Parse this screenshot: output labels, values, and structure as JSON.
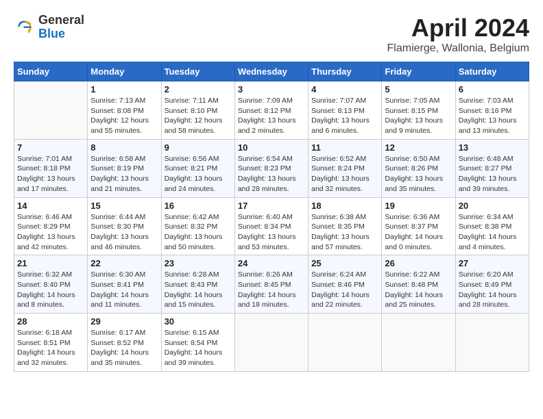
{
  "header": {
    "logo_general": "General",
    "logo_blue": "Blue",
    "title": "April 2024",
    "location": "Flamierge, Wallonia, Belgium"
  },
  "calendar": {
    "weekdays": [
      "Sunday",
      "Monday",
      "Tuesday",
      "Wednesday",
      "Thursday",
      "Friday",
      "Saturday"
    ],
    "weeks": [
      [
        {
          "day": "",
          "info": ""
        },
        {
          "day": "1",
          "info": "Sunrise: 7:13 AM\nSunset: 8:08 PM\nDaylight: 12 hours\nand 55 minutes."
        },
        {
          "day": "2",
          "info": "Sunrise: 7:11 AM\nSunset: 8:10 PM\nDaylight: 12 hours\nand 58 minutes."
        },
        {
          "day": "3",
          "info": "Sunrise: 7:09 AM\nSunset: 8:12 PM\nDaylight: 13 hours\nand 2 minutes."
        },
        {
          "day": "4",
          "info": "Sunrise: 7:07 AM\nSunset: 8:13 PM\nDaylight: 13 hours\nand 6 minutes."
        },
        {
          "day": "5",
          "info": "Sunrise: 7:05 AM\nSunset: 8:15 PM\nDaylight: 13 hours\nand 9 minutes."
        },
        {
          "day": "6",
          "info": "Sunrise: 7:03 AM\nSunset: 8:16 PM\nDaylight: 13 hours\nand 13 minutes."
        }
      ],
      [
        {
          "day": "7",
          "info": "Sunrise: 7:01 AM\nSunset: 8:18 PM\nDaylight: 13 hours\nand 17 minutes."
        },
        {
          "day": "8",
          "info": "Sunrise: 6:58 AM\nSunset: 8:19 PM\nDaylight: 13 hours\nand 21 minutes."
        },
        {
          "day": "9",
          "info": "Sunrise: 6:56 AM\nSunset: 8:21 PM\nDaylight: 13 hours\nand 24 minutes."
        },
        {
          "day": "10",
          "info": "Sunrise: 6:54 AM\nSunset: 8:23 PM\nDaylight: 13 hours\nand 28 minutes."
        },
        {
          "day": "11",
          "info": "Sunrise: 6:52 AM\nSunset: 8:24 PM\nDaylight: 13 hours\nand 32 minutes."
        },
        {
          "day": "12",
          "info": "Sunrise: 6:50 AM\nSunset: 8:26 PM\nDaylight: 13 hours\nand 35 minutes."
        },
        {
          "day": "13",
          "info": "Sunrise: 6:48 AM\nSunset: 8:27 PM\nDaylight: 13 hours\nand 39 minutes."
        }
      ],
      [
        {
          "day": "14",
          "info": "Sunrise: 6:46 AM\nSunset: 8:29 PM\nDaylight: 13 hours\nand 42 minutes."
        },
        {
          "day": "15",
          "info": "Sunrise: 6:44 AM\nSunset: 8:30 PM\nDaylight: 13 hours\nand 46 minutes."
        },
        {
          "day": "16",
          "info": "Sunrise: 6:42 AM\nSunset: 8:32 PM\nDaylight: 13 hours\nand 50 minutes."
        },
        {
          "day": "17",
          "info": "Sunrise: 6:40 AM\nSunset: 8:34 PM\nDaylight: 13 hours\nand 53 minutes."
        },
        {
          "day": "18",
          "info": "Sunrise: 6:38 AM\nSunset: 8:35 PM\nDaylight: 13 hours\nand 57 minutes."
        },
        {
          "day": "19",
          "info": "Sunrise: 6:36 AM\nSunset: 8:37 PM\nDaylight: 14 hours\nand 0 minutes."
        },
        {
          "day": "20",
          "info": "Sunrise: 6:34 AM\nSunset: 8:38 PM\nDaylight: 14 hours\nand 4 minutes."
        }
      ],
      [
        {
          "day": "21",
          "info": "Sunrise: 6:32 AM\nSunset: 8:40 PM\nDaylight: 14 hours\nand 8 minutes."
        },
        {
          "day": "22",
          "info": "Sunrise: 6:30 AM\nSunset: 8:41 PM\nDaylight: 14 hours\nand 11 minutes."
        },
        {
          "day": "23",
          "info": "Sunrise: 6:28 AM\nSunset: 8:43 PM\nDaylight: 14 hours\nand 15 minutes."
        },
        {
          "day": "24",
          "info": "Sunrise: 6:26 AM\nSunset: 8:45 PM\nDaylight: 14 hours\nand 18 minutes."
        },
        {
          "day": "25",
          "info": "Sunrise: 6:24 AM\nSunset: 8:46 PM\nDaylight: 14 hours\nand 22 minutes."
        },
        {
          "day": "26",
          "info": "Sunrise: 6:22 AM\nSunset: 8:48 PM\nDaylight: 14 hours\nand 25 minutes."
        },
        {
          "day": "27",
          "info": "Sunrise: 6:20 AM\nSunset: 8:49 PM\nDaylight: 14 hours\nand 28 minutes."
        }
      ],
      [
        {
          "day": "28",
          "info": "Sunrise: 6:18 AM\nSunset: 8:51 PM\nDaylight: 14 hours\nand 32 minutes."
        },
        {
          "day": "29",
          "info": "Sunrise: 6:17 AM\nSunset: 8:52 PM\nDaylight: 14 hours\nand 35 minutes."
        },
        {
          "day": "30",
          "info": "Sunrise: 6:15 AM\nSunset: 8:54 PM\nDaylight: 14 hours\nand 39 minutes."
        },
        {
          "day": "",
          "info": ""
        },
        {
          "day": "",
          "info": ""
        },
        {
          "day": "",
          "info": ""
        },
        {
          "day": "",
          "info": ""
        }
      ]
    ]
  }
}
